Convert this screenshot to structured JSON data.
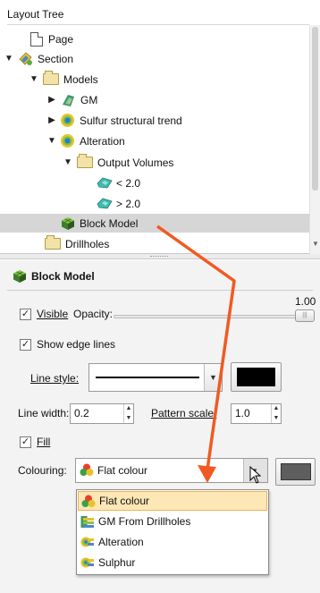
{
  "tree_panel": {
    "title": "Layout Tree",
    "items": [
      {
        "label": "Page",
        "toggle": "",
        "icon": "page-icon"
      },
      {
        "label": "Section",
        "toggle": "▼",
        "icon": "section-icon"
      },
      {
        "label": "Models",
        "toggle": "▼",
        "icon": "folder-icon"
      },
      {
        "label": "GM",
        "toggle": "▶",
        "icon": "geological-model-icon"
      },
      {
        "label": "Sulfur structural trend",
        "toggle": "▶",
        "icon": "interpolant-icon"
      },
      {
        "label": "Alteration",
        "toggle": "▼",
        "icon": "interpolant-icon"
      },
      {
        "label": "Output Volumes",
        "toggle": "▼",
        "icon": "folder-icon"
      },
      {
        "label": "< 2.0",
        "toggle": "",
        "icon": "volume-icon"
      },
      {
        "label": "> 2.0",
        "toggle": "",
        "icon": "volume-icon"
      },
      {
        "label": "Block Model",
        "toggle": "",
        "icon": "block-model-icon",
        "selected": true
      },
      {
        "label": "Drillholes",
        "toggle": "",
        "icon": "folder-icon"
      }
    ]
  },
  "properties": {
    "header": "Block Model",
    "visible_label": "Visible",
    "visible_checked": true,
    "opacity_label": "Opacity:",
    "opacity_value": "1.00",
    "show_edge_lines_label": "Show edge lines",
    "show_edge_lines_checked": true,
    "line_style_label": "Line style:",
    "line_colour": "#000000",
    "line_width_label": "Line width:",
    "line_width_value": "0.2",
    "pattern_scale_label": "Pattern scale:",
    "pattern_scale_value": "1.0",
    "fill_label": "Fill",
    "fill_checked": true,
    "colouring_label": "Colouring:",
    "colouring_value": "Flat colour",
    "fill_colour": "#5e5e5e",
    "colouring_options": [
      {
        "label": "Flat colour",
        "icon": "flat-colour-icon",
        "highlighted": true
      },
      {
        "label": "GM From Drillholes",
        "icon": "geological-model-colouring-icon"
      },
      {
        "label": "Alteration",
        "icon": "interpolant-colouring-icon"
      },
      {
        "label": "Sulphur",
        "icon": "interpolant-colouring-icon"
      }
    ]
  },
  "colors": {
    "annotation_arrow": "#f05a22",
    "selection_bg": "#d6d6d6",
    "dropdown_highlight": "#fde7b5"
  }
}
